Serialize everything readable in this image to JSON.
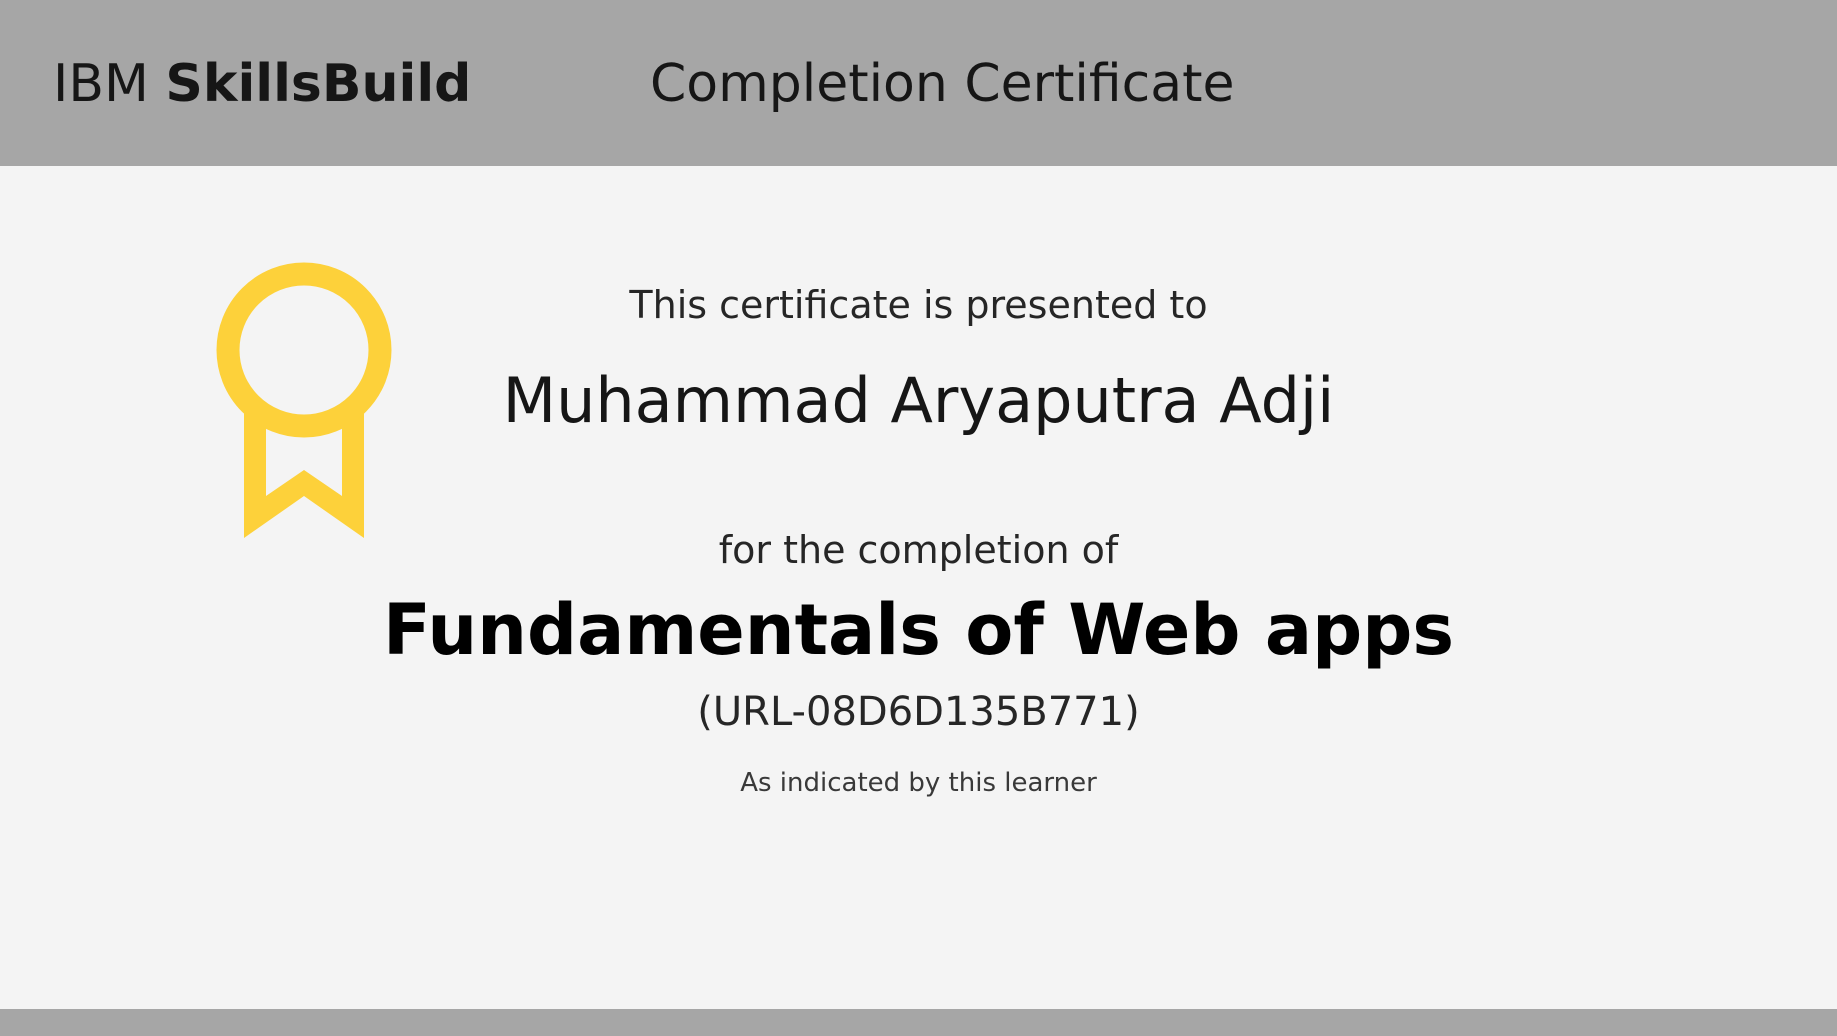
{
  "header": {
    "brand_light": "IBM",
    "brand_bold": "SkillsBuild",
    "title": "Completion Certificate"
  },
  "certificate": {
    "presented_text": "This certificate is presented to",
    "recipient": "Muhammad Aryaputra Adji",
    "completion_text": "for the completion of",
    "course_title": "Fundamentals of Web apps",
    "course_code": "(URL-08D6D135B771)",
    "note": "As indicated by this learner"
  },
  "icons": {
    "medal": "award-ribbon-icon"
  },
  "colors": {
    "header_background": "#a6a6a6",
    "page_background": "#f4f4f4",
    "medal": "#fdd13a",
    "text": "#161616"
  }
}
